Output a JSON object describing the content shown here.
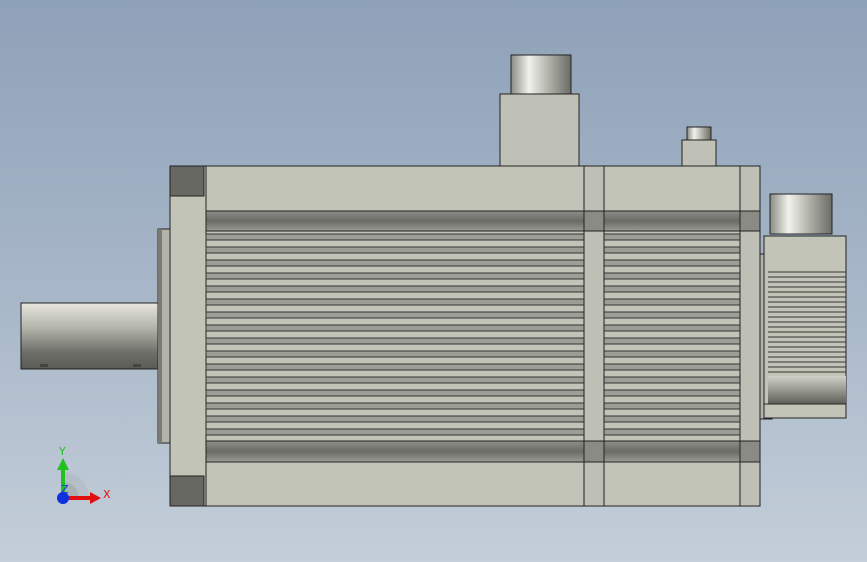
{
  "viewport": {
    "background_top": "#8ea1b8",
    "background_bottom": "#c4ced9",
    "model_color": "#c3c4b8",
    "shadow_color": "#6e6f68"
  },
  "triad": {
    "x_label": "X",
    "y_label": "Y",
    "z_label": "Z",
    "x_color": "#e01010",
    "y_color": "#20c020",
    "z_color": "#1030e0"
  }
}
